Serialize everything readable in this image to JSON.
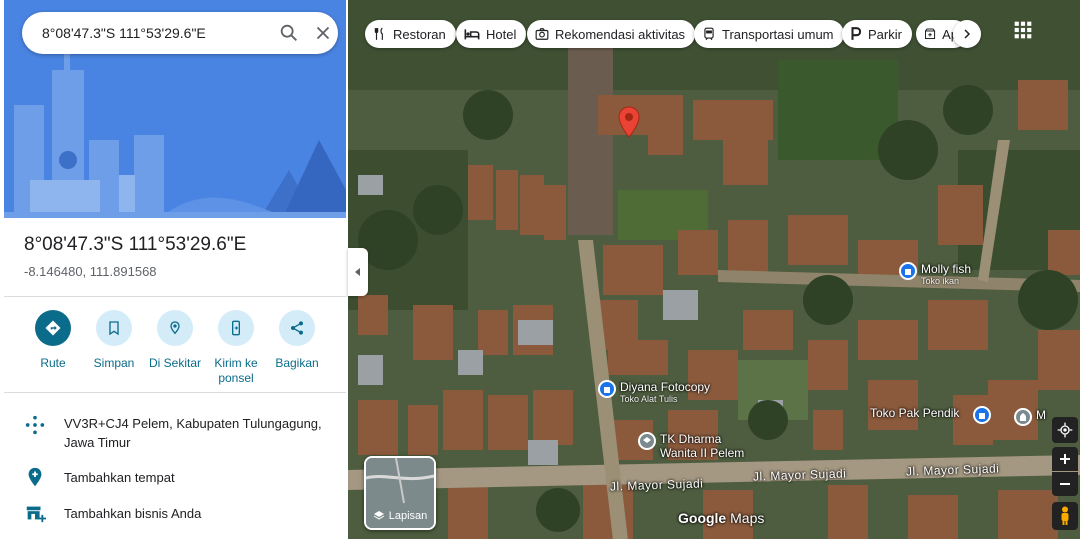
{
  "search": {
    "query": "8°08'47.3\"S 111°53'29.6\"E"
  },
  "place": {
    "title": "8°08'47.3\"S 111°53'29.6\"E",
    "decimal": "-8.146480, 111.891568"
  },
  "actions": [
    {
      "label": "Rute",
      "icon": "directions-icon"
    },
    {
      "label": "Simpan",
      "icon": "bookmark-icon"
    },
    {
      "label": "Di Sekitar",
      "icon": "nearby-icon"
    },
    {
      "label": "Kirim ke ponsel",
      "icon": "send-to-phone-icon"
    },
    {
      "label": "Bagikan",
      "icon": "share-icon"
    }
  ],
  "info": {
    "pluscode": "VV3R+CJ4 Pelem, Kabupaten Tulungagung, Jawa Timur",
    "add_place": "Tambahkan tempat",
    "add_business": "Tambahkan bisnis Anda"
  },
  "chips": [
    "Restoran",
    "Hotel",
    "Rekomendasi aktivitas",
    "Transportasi umum",
    "Parkir",
    "Ap"
  ],
  "pois": [
    {
      "name": "Molly fish",
      "sub": "Toko ikan"
    },
    {
      "name": "Diyana Fotocopy",
      "sub": "Toko Alat Tulis"
    },
    {
      "name": "TK Dharma",
      "sub": "Wanita II Pelem"
    },
    {
      "name": "Toko Pak Pendik",
      "sub": ""
    },
    {
      "name": "M",
      "sub": ""
    }
  ],
  "roads": [
    "Jl. Mayor Sujadi",
    "Jl. Mayor Sujadi",
    "Jl. Mayor Sujadi"
  ],
  "layers_label": "Lapisan",
  "watermark": {
    "brand": "Google",
    "product": "Maps"
  },
  "colors": {
    "accent": "#0b6b8a",
    "hero": "#4a84e3",
    "pin": "#ea4335",
    "poi": "#1a73e8"
  }
}
